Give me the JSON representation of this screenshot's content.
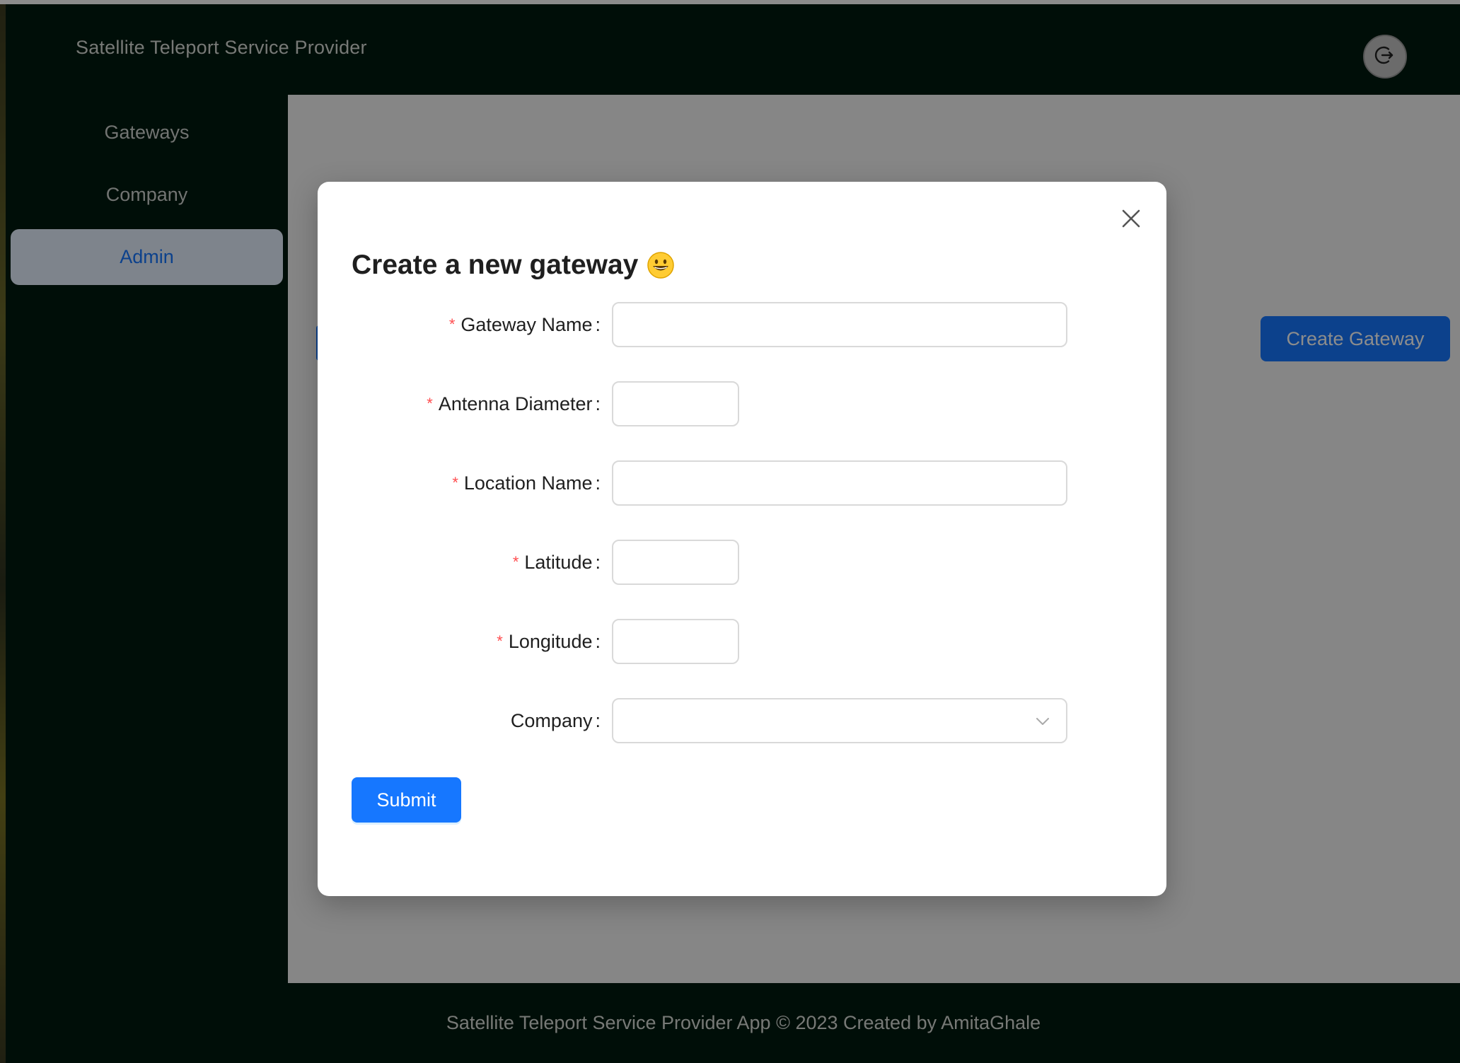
{
  "header": {
    "app_title": "Satellite Teleport Service Provider",
    "logout_icon": "logout-icon"
  },
  "sider": {
    "items": [
      {
        "label": "Gateways",
        "active": false
      },
      {
        "label": "Company",
        "active": false
      },
      {
        "label": "Admin",
        "active": true
      }
    ]
  },
  "content": {
    "create_button_label": "Create Gateway"
  },
  "footer": {
    "text": "Satellite Teleport Service Provider App © 2023 Created by AmitaGhale"
  },
  "modal": {
    "title": "Create a new gateway",
    "title_emoji": "grinning-face-icon",
    "close_icon": "close-icon",
    "fields": {
      "gateway_name": {
        "label": "Gateway Name",
        "required": true,
        "value": ""
      },
      "antenna_diameter": {
        "label": "Antenna Diameter",
        "required": true,
        "value": ""
      },
      "location_name": {
        "label": "Location Name",
        "required": true,
        "value": ""
      },
      "latitude": {
        "label": "Latitude",
        "required": true,
        "value": ""
      },
      "longitude": {
        "label": "Longitude",
        "required": true,
        "value": ""
      },
      "company": {
        "label": "Company",
        "required": false,
        "value": ""
      }
    },
    "required_mark": "*",
    "colon": ":",
    "submit_label": "Submit"
  },
  "colors": {
    "header_bg": "#001a10",
    "primary": "#1677ff",
    "required": "#ff4d4f",
    "mask": "rgba(0,0,0,0.45)"
  }
}
